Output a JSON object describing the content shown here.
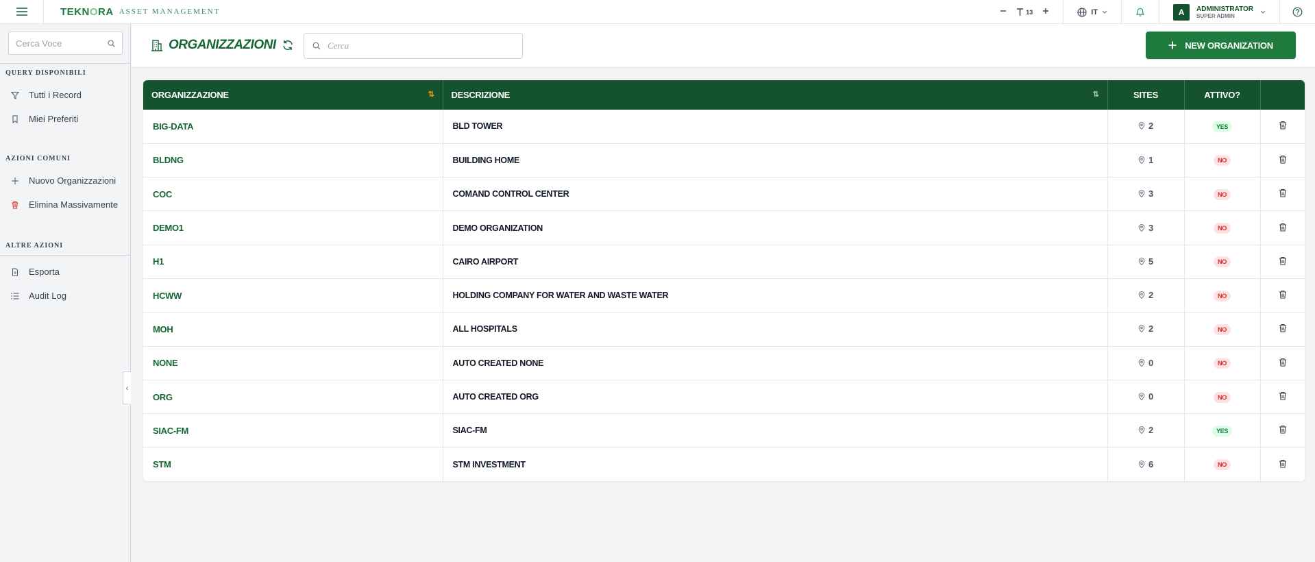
{
  "app": {
    "logo_main": "TEKN",
    "logo_o": "O",
    "logo_end": "RA",
    "subtitle": "ASSET MANAGEMENT"
  },
  "topbar": {
    "font_size_value": "13",
    "language": "IT",
    "user_initial": "A",
    "user_name": "ADMINISTRATOR",
    "user_role": "SUPER ADMIN"
  },
  "sidebar": {
    "search_placeholder": "Cerca Voce",
    "sections": [
      {
        "title": "QUERY DISPONIBILI",
        "items": [
          {
            "label": "Tutti i Record",
            "icon": "filter-icon"
          },
          {
            "label": "Miei Preferiti",
            "icon": "bookmark-icon"
          }
        ]
      },
      {
        "title": "AZIONI COMUNI",
        "items": [
          {
            "label": "Nuovo Organizzazioni",
            "icon": "plus-icon"
          },
          {
            "label": "Elimina Massivamente",
            "icon": "trash-icon"
          }
        ]
      },
      {
        "title": "ALTRE AZIONI",
        "items": [
          {
            "label": "Esporta",
            "icon": "file-icon"
          },
          {
            "label": "Audit Log",
            "icon": "list-icon"
          }
        ]
      }
    ]
  },
  "header": {
    "title": "ORGANIZZAZIONI",
    "search_placeholder": "Cerca",
    "new_button_label": "NEW ORGANIZATION"
  },
  "table": {
    "columns": {
      "code": "ORGANIZZAZIONE",
      "description": "DESCRIZIONE",
      "sites": "SITES",
      "active": "ATTIVO?"
    },
    "rows": [
      {
        "code": "BIG-DATA",
        "description": "BLD TOWER",
        "sites": "2",
        "active": "YES"
      },
      {
        "code": "BLDNG",
        "description": "BUILDING HOME",
        "sites": "1",
        "active": "NO"
      },
      {
        "code": "COC",
        "description": "COMAND CONTROL CENTER",
        "sites": "3",
        "active": "NO"
      },
      {
        "code": "DEMO1",
        "description": "DEMO ORGANIZATION",
        "sites": "3",
        "active": "NO"
      },
      {
        "code": "H1",
        "description": "CAIRO AIRPORT",
        "sites": "5",
        "active": "NO"
      },
      {
        "code": "HCWW",
        "description": "HOLDING COMPANY FOR WATER AND WASTE WATER",
        "sites": "2",
        "active": "NO"
      },
      {
        "code": "MOH",
        "description": "ALL HOSPITALS",
        "sites": "2",
        "active": "NO"
      },
      {
        "code": "NONE",
        "description": "AUTO CREATED NONE",
        "sites": "0",
        "active": "NO"
      },
      {
        "code": "ORG",
        "description": "AUTO CREATED ORG",
        "sites": "0",
        "active": "NO"
      },
      {
        "code": "SIAC-FM",
        "description": "SIAC-FM",
        "sites": "2",
        "active": "YES"
      },
      {
        "code": "STM",
        "description": "STM INVESTMENT",
        "sites": "6",
        "active": "NO"
      }
    ]
  },
  "colors": {
    "brand": "#1f7a3d",
    "header_dark": "#14532d"
  }
}
